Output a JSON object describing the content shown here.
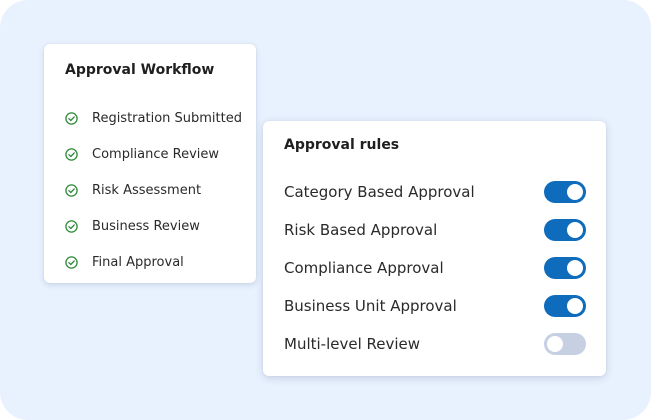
{
  "workflow": {
    "title": "Approval Workflow",
    "steps": [
      {
        "label": "Registration Submitted",
        "status": "complete"
      },
      {
        "label": "Compliance Review",
        "status": "complete"
      },
      {
        "label": "Risk Assessment",
        "status": "complete"
      },
      {
        "label": "Business Review",
        "status": "complete"
      },
      {
        "label": "Final Approval",
        "status": "complete"
      }
    ]
  },
  "rules": {
    "title": "Approval rules",
    "items": [
      {
        "label": "Category Based Approval",
        "enabled": true
      },
      {
        "label": "Risk Based Approval",
        "enabled": true
      },
      {
        "label": "Compliance Approval",
        "enabled": true
      },
      {
        "label": "Business Unit Approval",
        "enabled": true
      },
      {
        "label": "Multi-level Review",
        "enabled": false
      }
    ]
  },
  "colors": {
    "background": "#e8f1fe",
    "check": "#2e8b3a",
    "toggle_on": "#0f6cbd",
    "toggle_off": "#c7d0e2"
  },
  "icons": {
    "step_complete": "check-circle-icon"
  }
}
